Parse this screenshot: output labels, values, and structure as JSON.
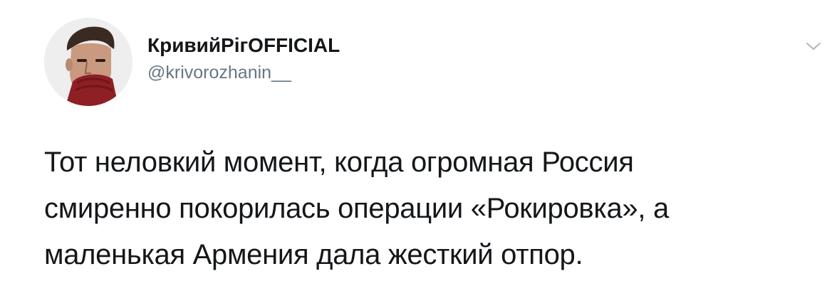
{
  "tweet": {
    "author": {
      "display_name": "КривийРігOFFICIAL",
      "handle": "@krivorozhanin__",
      "avatar_icon": "person-photo-icon"
    },
    "menu_icon": "chevron-down-icon",
    "text_lines": [
      "Тот неловкий момент, когда огромная Россия",
      "смиренно покорилась операции «Рокировка», а",
      "маленькая Армения дала жесткий отпор."
    ]
  },
  "colors": {
    "text_primary": "#14171a",
    "text_secondary": "#657786",
    "caret": "#aab8c2",
    "background": "#ffffff"
  }
}
